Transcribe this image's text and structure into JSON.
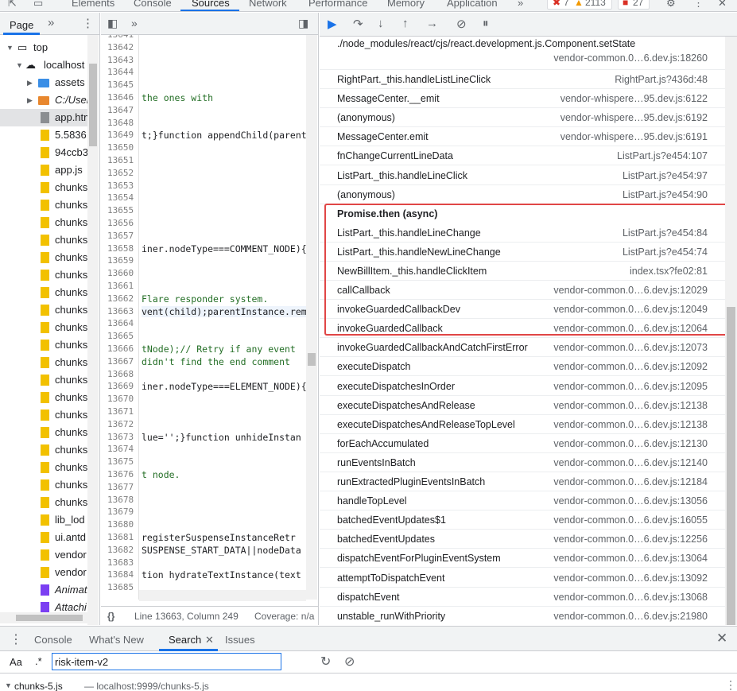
{
  "toolbar": {
    "tabs": [
      "Elements",
      "Console",
      "Sources",
      "Network",
      "Performance",
      "Memory",
      "Application"
    ],
    "active_tab": "Sources",
    "more": "»",
    "errors": "7",
    "warnings": "2113",
    "issues": "27"
  },
  "navigator": {
    "tab": "Page",
    "more": "»",
    "items": [
      {
        "label": "top",
        "type": "frame"
      },
      {
        "label": "localhost",
        "type": "cloud"
      },
      {
        "label": "assets",
        "type": "folder-b"
      },
      {
        "label": "C:/Users",
        "type": "folder-o"
      },
      {
        "label": "app.html",
        "type": "html"
      },
      {
        "label": "5.5836",
        "type": "js"
      },
      {
        "label": "94ccb3",
        "type": "js"
      },
      {
        "label": "app.js",
        "type": "js"
      },
      {
        "label": "chunks",
        "type": "js"
      },
      {
        "label": "chunks",
        "type": "js"
      },
      {
        "label": "chunks",
        "type": "js"
      },
      {
        "label": "chunks",
        "type": "js"
      },
      {
        "label": "chunks",
        "type": "js"
      },
      {
        "label": "chunks",
        "type": "js"
      },
      {
        "label": "chunks",
        "type": "js"
      },
      {
        "label": "chunks",
        "type": "js"
      },
      {
        "label": "chunks",
        "type": "js"
      },
      {
        "label": "chunks",
        "type": "js"
      },
      {
        "label": "chunks",
        "type": "js"
      },
      {
        "label": "chunks",
        "type": "js"
      },
      {
        "label": "chunks",
        "type": "js"
      },
      {
        "label": "chunks",
        "type": "js"
      },
      {
        "label": "chunks",
        "type": "js"
      },
      {
        "label": "chunks",
        "type": "js"
      },
      {
        "label": "chunks",
        "type": "js"
      },
      {
        "label": "chunks",
        "type": "js"
      },
      {
        "label": "chunks",
        "type": "js"
      },
      {
        "label": "lib_lod",
        "type": "js"
      },
      {
        "label": "ui.antd",
        "type": "js"
      },
      {
        "label": "vendor",
        "type": "js"
      },
      {
        "label": "vendor",
        "type": "js"
      },
      {
        "label": "Animati",
        "type": "purple"
      },
      {
        "label": "Attachi",
        "type": "purple"
      }
    ]
  },
  "editor": {
    "line_numbers": [
      "13641",
      "13642",
      "13643",
      "13644",
      "13645",
      "13646",
      "13647",
      "13648",
      "13649",
      "13650",
      "13651",
      "13652",
      "13653",
      "13654",
      "13655",
      "13656",
      "13657",
      "13658",
      "13659",
      "13660",
      "13661",
      "13662",
      "13663",
      "13664",
      "13665",
      "13666",
      "13667",
      "13668",
      "13669",
      "13670",
      "13671",
      "13672",
      "13673",
      "13674",
      "13675",
      "13676",
      "13677",
      "13678",
      "13679",
      "13680",
      "13681",
      "13682",
      "13683",
      "13684",
      "13685"
    ],
    "code_lines": [
      {
        "line": "13646",
        "text": " the ones with",
        "kind": "cm"
      },
      {
        "line": "13649",
        "text": "t;}function appendChild(parent",
        "kind": "code"
      },
      {
        "line": "13658",
        "text": "iner.nodeType===COMMENT_NODE){",
        "kind": "code"
      },
      {
        "line": "13662",
        "text": "Flare responder system.",
        "kind": "cm"
      },
      {
        "line": "13663",
        "text": "vent(child);parentInstance.rem",
        "kind": "code"
      },
      {
        "line": "13666",
        "text": "tNode);// Retry if any event",
        "kind": "cm"
      },
      {
        "line": "13667",
        "text": " didn't find the end comment",
        "kind": "cm"
      },
      {
        "line": "13669",
        "text": "iner.nodeType===ELEMENT_NODE){",
        "kind": "code"
      },
      {
        "line": "13673",
        "text": "lue='';}function unhideInstan",
        "kind": "code"
      },
      {
        "line": "13676",
        "text": "t node.",
        "kind": "cm"
      },
      {
        "line": "13681",
        "text": " registerSuspenseInstanceRetr",
        "kind": "code"
      },
      {
        "line": "13682",
        "text": "SUSPENSE_START_DATA||nodeData",
        "kind": "code"
      },
      {
        "line": "13684",
        "text": "tion hydrateTextInstance(text",
        "kind": "code"
      }
    ],
    "status": "Line 13663, Column 249",
    "coverage": "Coverage: n/a"
  },
  "callstack": {
    "frames": [
      {
        "fn": "./node_modules/react/cjs/react.development.js.Component.setState",
        "loc": "vendor-common.0…6.dev.js:18260"
      },
      {
        "fn": "RightPart._this.handleListLineClick",
        "loc": "RightPart.js?436d:48"
      },
      {
        "fn": "MessageCenter.__emit",
        "loc": "vendor-whispere…95.dev.js:6122"
      },
      {
        "fn": "(anonymous)",
        "loc": "vendor-whispere…95.dev.js:6192"
      },
      {
        "fn": "MessageCenter.emit",
        "loc": "vendor-whispere…95.dev.js:6191"
      },
      {
        "fn": "fnChangeCurrentLineData",
        "loc": "ListPart.js?e454:107"
      },
      {
        "fn": "ListPart._this.handleLineClick",
        "loc": "ListPart.js?e454:97"
      },
      {
        "fn": "(anonymous)",
        "loc": "ListPart.js?e454:90"
      },
      {
        "fn": "Promise.then (async)",
        "loc": ""
      },
      {
        "fn": "ListPart._this.handleLineChange",
        "loc": "ListPart.js?e454:84"
      },
      {
        "fn": "ListPart._this.handleNewLineChange",
        "loc": "ListPart.js?e454:74"
      },
      {
        "fn": "NewBillItem._this.handleClickItem",
        "loc": "index.tsx?fe02:81"
      },
      {
        "fn": "callCallback",
        "loc": "vendor-common.0…6.dev.js:12029"
      },
      {
        "fn": "invokeGuardedCallbackDev",
        "loc": "vendor-common.0…6.dev.js:12049"
      },
      {
        "fn": "invokeGuardedCallback",
        "loc": "vendor-common.0…6.dev.js:12064"
      },
      {
        "fn": "invokeGuardedCallbackAndCatchFirstError",
        "loc": "vendor-common.0…6.dev.js:12073"
      },
      {
        "fn": "executeDispatch",
        "loc": "vendor-common.0…6.dev.js:12092"
      },
      {
        "fn": "executeDispatchesInOrder",
        "loc": "vendor-common.0…6.dev.js:12095"
      },
      {
        "fn": "executeDispatchesAndRelease",
        "loc": "vendor-common.0…6.dev.js:12138"
      },
      {
        "fn": "executeDispatchesAndReleaseTopLevel",
        "loc": "vendor-common.0…6.dev.js:12138"
      },
      {
        "fn": "forEachAccumulated",
        "loc": "vendor-common.0…6.dev.js:12130"
      },
      {
        "fn": "runEventsInBatch",
        "loc": "vendor-common.0…6.dev.js:12140"
      },
      {
        "fn": "runExtractedPluginEventsInBatch",
        "loc": "vendor-common.0…6.dev.js:12184"
      },
      {
        "fn": "handleTopLevel",
        "loc": "vendor-common.0…6.dev.js:13056"
      },
      {
        "fn": "batchedEventUpdates$1",
        "loc": "vendor-common.0…6.dev.js:16055"
      },
      {
        "fn": "batchedEventUpdates",
        "loc": "vendor-common.0…6.dev.js:12256"
      },
      {
        "fn": "dispatchEventForPluginEventSystem",
        "loc": "vendor-common.0…6.dev.js:13064"
      },
      {
        "fn": "attemptToDispatchEvent",
        "loc": "vendor-common.0…6.dev.js:13092"
      },
      {
        "fn": "dispatchEvent",
        "loc": "vendor-common.0…6.dev.js:13068"
      },
      {
        "fn": "unstable_runWithPriority",
        "loc": "vendor-common.0…6.dev.js:21980"
      }
    ]
  },
  "drawer": {
    "tabs": [
      "Console",
      "What's New",
      "Search",
      "Issues"
    ],
    "active_tab": "Search",
    "search": {
      "case_label": "Aa",
      "regex_label": ".*",
      "value": "risk-item-v2"
    },
    "result": {
      "file": "chunks-5.js",
      "path": "— localhost:9999/chunks-5.js"
    }
  },
  "colors": {
    "accent": "#1a73e8",
    "highlight_box": "#e04646"
  }
}
